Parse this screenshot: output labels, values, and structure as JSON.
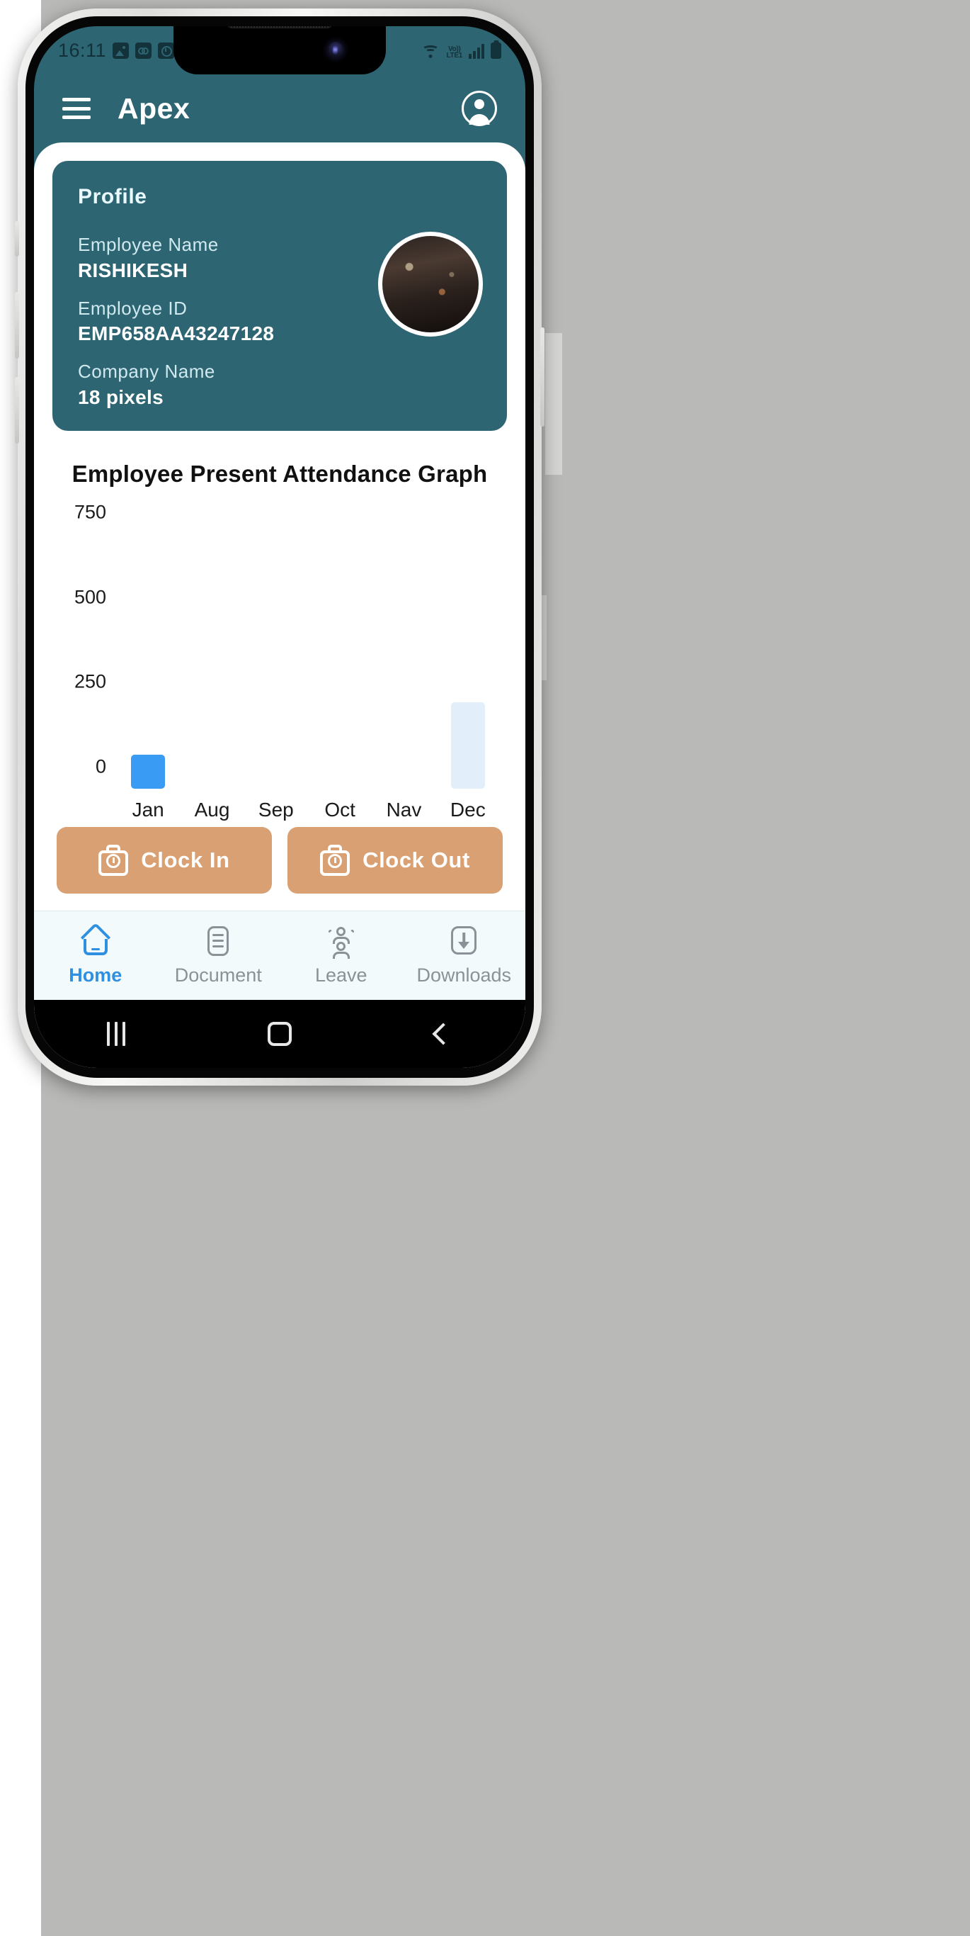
{
  "status_bar": {
    "time": "16:11",
    "left_icons": [
      "image-icon",
      "voicemail-icon",
      "alarm-clock-icon"
    ],
    "network_label": "Vo)) LTE1",
    "volte_line1": "Vo))",
    "volte_line2": "LTE1",
    "right_icons": [
      "wifi-icon",
      "volte-icon",
      "signal-bars-icon",
      "battery-icon"
    ]
  },
  "header": {
    "menu_icon": "hamburger-menu-icon",
    "title": "Apex",
    "account_icon": "account-circle-icon"
  },
  "profile": {
    "card_title": "Profile",
    "fields": [
      {
        "label": "Employee Name",
        "value": "RISHIKESH"
      },
      {
        "label": "Employee ID",
        "value": "EMP658AA43247128"
      },
      {
        "label": "Company Name",
        "value": "18 pixels"
      }
    ],
    "avatar_alt": "profile-photo"
  },
  "chart_data": {
    "type": "bar",
    "title": "Employee Present Attendance Graph",
    "xlabel": "",
    "ylabel": "",
    "categories": [
      "Jan",
      "Aug",
      "Sep",
      "Oct",
      "Nav",
      "Dec"
    ],
    "values": [
      100,
      0,
      0,
      0,
      0,
      255
    ],
    "bar_colors": [
      "#3a9bf4",
      "#3a9bf4",
      "#3a9bf4",
      "#3a9bf4",
      "#3a9bf4",
      "#e2effb"
    ],
    "yticks": [
      0,
      250,
      500,
      750
    ],
    "ytick_labels": [
      "0",
      "250",
      "500",
      "750"
    ],
    "ylim": [
      0,
      830
    ],
    "grid": false,
    "legend": "none"
  },
  "actions": {
    "clock_in": {
      "label": "Clock In",
      "icon": "time-clock-icon"
    },
    "clock_out": {
      "label": "Clock Out",
      "icon": "time-clock-icon"
    },
    "button_color": "#d9a173"
  },
  "bottom_nav": {
    "active": "Home",
    "items": [
      {
        "label": "Home",
        "icon": "home-icon"
      },
      {
        "label": "Document",
        "icon": "document-icon"
      },
      {
        "label": "Leave",
        "icon": "people-leave-icon"
      },
      {
        "label": "Downloads",
        "icon": "download-icon"
      }
    ]
  },
  "android_nav": {
    "recents": "recents-icon",
    "home": "home-square-icon",
    "back": "back-chevron-icon"
  },
  "theme": {
    "primary": "#2d6572",
    "accent_blue": "#2f8fe0",
    "bar_blue": "#3a9bf4",
    "bar_pale": "#e2effb",
    "button_tan": "#d9a173"
  }
}
